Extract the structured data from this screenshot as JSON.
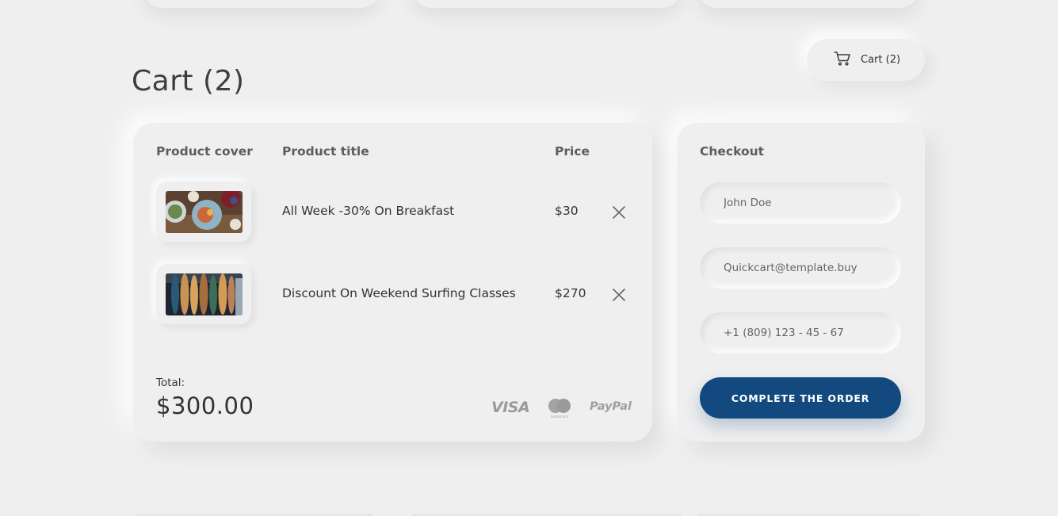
{
  "cart_button": {
    "label": "Cart (2)",
    "icon": "cart-icon"
  },
  "page": {
    "title": "Cart (2)"
  },
  "cart": {
    "columns": {
      "cover": "Product cover",
      "title": "Product title",
      "price": "Price"
    },
    "items": [
      {
        "title": "All Week -30% On Breakfast",
        "price": "$30",
        "image": "breakfast-table"
      },
      {
        "title": "Discount On Weekend Surfing Classes",
        "price": "$270",
        "image": "surfboards"
      }
    ],
    "total_label": "Total:",
    "total_value": "$300.00",
    "payment_methods": {
      "visa": "VISA",
      "mastercard": "mastercard",
      "paypal": "PayPal"
    }
  },
  "checkout": {
    "title": "Checkout",
    "name_placeholder": "John Doe",
    "email_placeholder": "Quickcart@template.buy",
    "phone_placeholder": "+1 (809) 123 - 45 - 67",
    "submit_label": "COMPLETE THE ORDER"
  },
  "colors": {
    "accent": "#12497e",
    "background": "#efefef"
  }
}
